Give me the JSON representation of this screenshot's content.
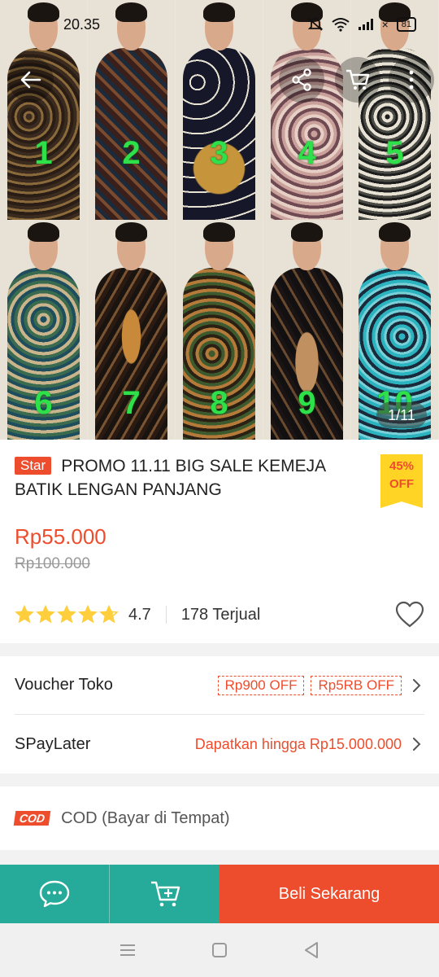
{
  "status_bar": {
    "time": "20.35",
    "battery": "81",
    "x_mark": "×"
  },
  "top_nav": {
    "back_icon": "arrow-left-icon",
    "share_icon": "share-icon",
    "cart_icon": "cart-icon",
    "more_icon": "more-vertical-icon"
  },
  "gallery": {
    "counter": "1/11",
    "numbers": [
      "1",
      "2",
      "3",
      "4",
      "5",
      "6",
      "7",
      "8",
      "9",
      "10"
    ]
  },
  "product": {
    "badge": "Star",
    "title": "PROMO 11.11 BIG SALE KEMEJA BATIK LENGAN PANJANG",
    "discount_pct": "45%",
    "discount_label": "OFF",
    "price": "Rp55.000",
    "original_price": "Rp100.000",
    "rating": "4.7",
    "rating_value": 4.7,
    "sold": "178 Terjual"
  },
  "vouchers": {
    "label": "Voucher Toko",
    "tags": [
      "Rp900 OFF",
      "Rp5RB OFF"
    ]
  },
  "paylater": {
    "label": "SPayLater",
    "text": "Dapatkan hingga Rp15.000.000"
  },
  "cod": {
    "badge": "COD",
    "label": "COD (Bayar di Tempat)"
  },
  "actions": {
    "buy_now": "Beli Sekarang"
  },
  "colors": {
    "primary": "#ee4d2d",
    "teal": "#26aa99",
    "star": "#ffce3d",
    "discount_bg": "#ffd424"
  }
}
